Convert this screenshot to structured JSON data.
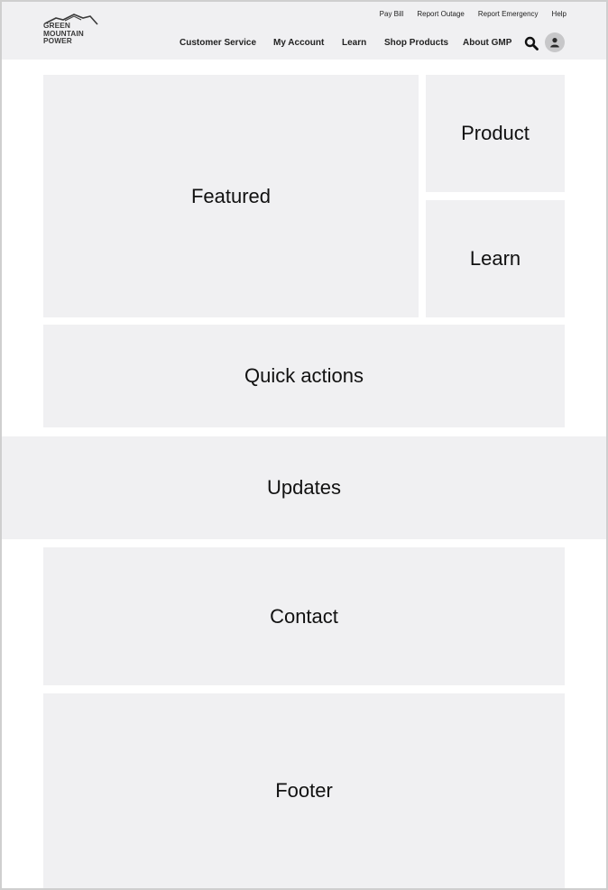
{
  "brand": {
    "logo_lines": [
      "GREEN",
      "MOUNTAIN",
      "POWER"
    ]
  },
  "utility_nav": {
    "items": [
      "Pay Bill",
      "Report Outage",
      "Report Emergency",
      "Help"
    ]
  },
  "main_nav": {
    "items": [
      "Customer Service",
      "My Account",
      "Learn",
      "Shop Products",
      "About GMP"
    ]
  },
  "icons": {
    "search": "search-icon",
    "account": "user-icon"
  },
  "sections": {
    "featured": "Featured",
    "product": "Product",
    "learn": "Learn",
    "quick_actions": "Quick actions",
    "updates": "Updates",
    "contact": "Contact",
    "footer": "Footer"
  },
  "colors": {
    "block_fill": "#f0f0f2",
    "frame_border": "#cfcfcf"
  }
}
